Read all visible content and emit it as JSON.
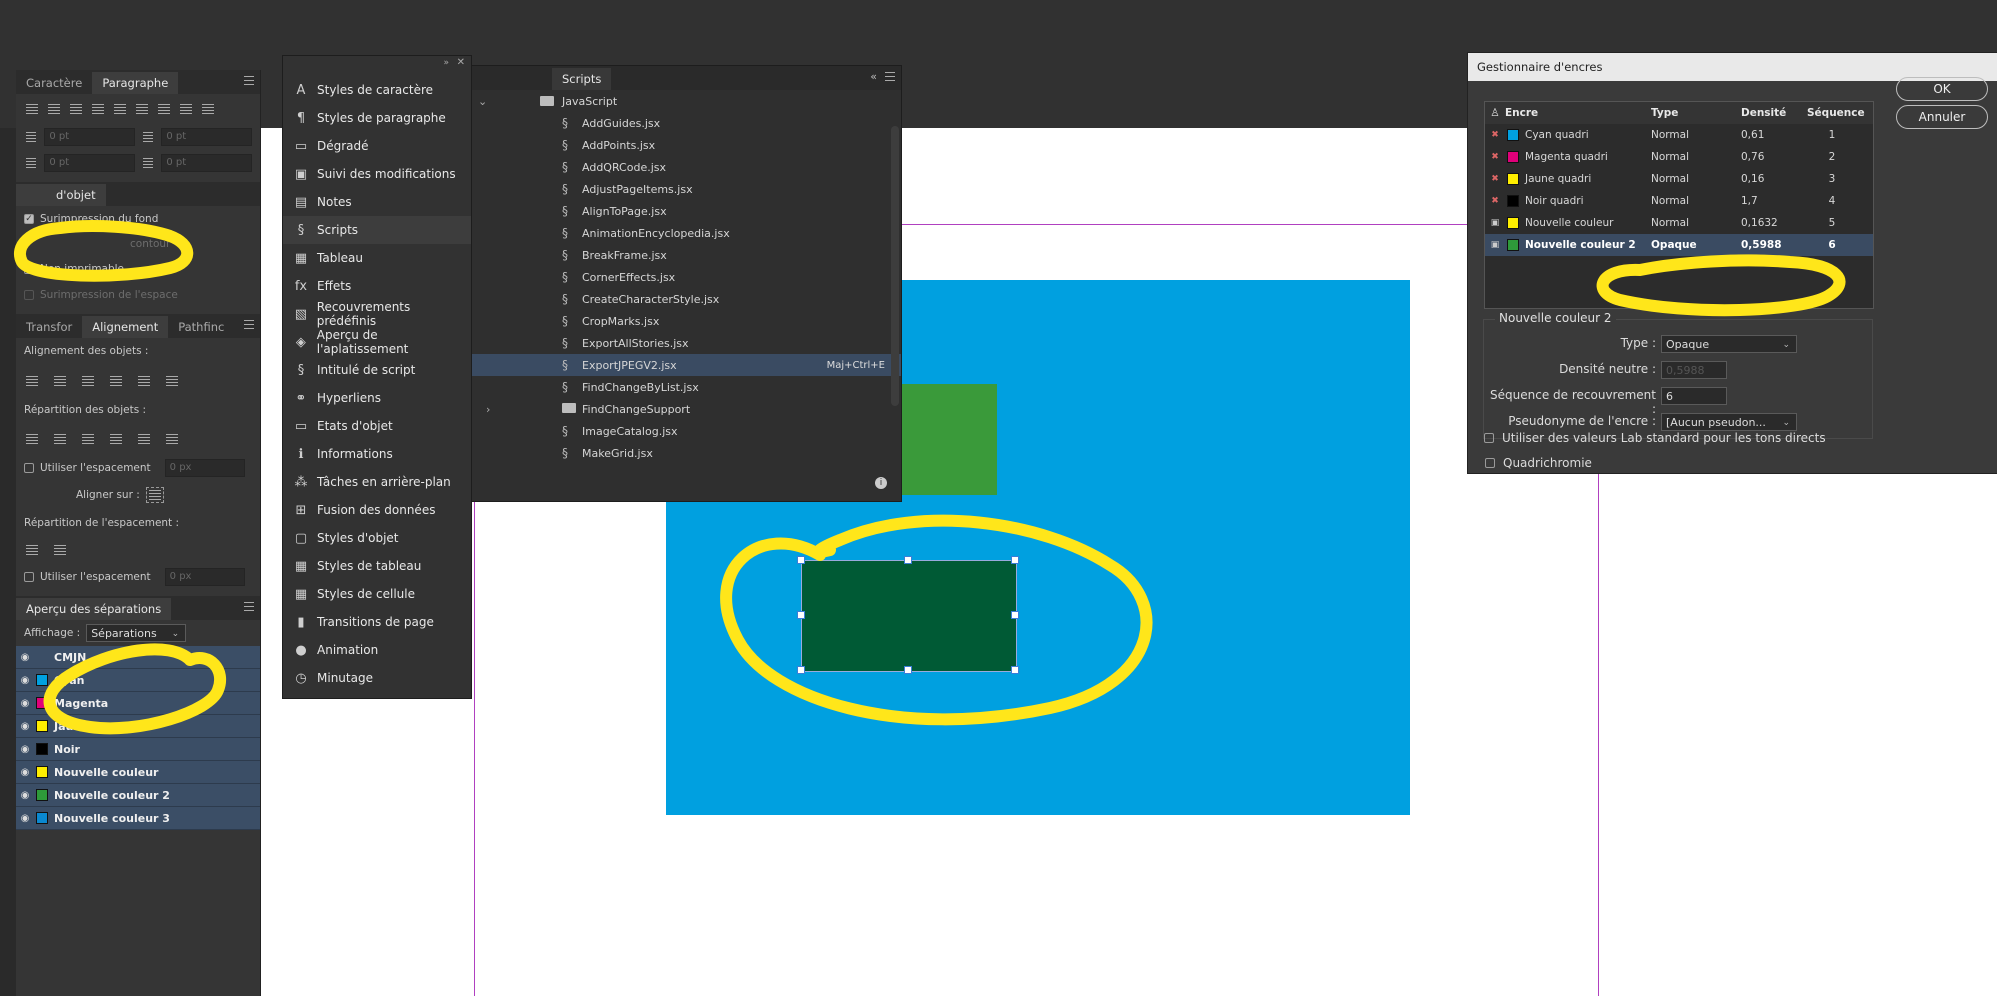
{
  "left_panel": {
    "tabs": [
      "Caractère",
      "Paragraphe"
    ],
    "attributes_header": "d'objet",
    "options": [
      {
        "label": "Surimpression du fond",
        "checked": true
      },
      {
        "label": "contour",
        "checked": false
      },
      {
        "label": "Non imprimable",
        "checked": false
      },
      {
        "label": "Surimpression de l'espace",
        "checked": false
      }
    ],
    "indent_value": "0 pt",
    "align_tabs": [
      "Transfor",
      "Alignement",
      "Pathfinc"
    ],
    "align_objects_label": "Alignement des objets :",
    "distribute_objects_label": "Répartition des objets :",
    "use_spacing_label": "Utiliser l'espacement",
    "spacing_value": "0 px",
    "align_to_label": "Aligner sur :",
    "distribute_spacing_label": "Répartition de l'espacement :"
  },
  "separations": {
    "title": "Aperçu des séparations",
    "display_label": "Affichage :",
    "display_value": "Séparations",
    "rows": [
      {
        "name": "CMJN",
        "color": ""
      },
      {
        "name": "Cyan",
        "color": "#00a0e0"
      },
      {
        "name": "Magenta",
        "color": "#e0007a"
      },
      {
        "name": "Jaune",
        "color": "#ffee00"
      },
      {
        "name": "Noir",
        "color": "#000000"
      },
      {
        "name": "Nouvelle couleur",
        "color": "#ffee00"
      },
      {
        "name": "Nouvelle couleur 2",
        "color": "#2e9a3a"
      },
      {
        "name": "Nouvelle couleur 3",
        "color": "#0a88d0"
      }
    ]
  },
  "menu": {
    "items": [
      {
        "label": "Styles de caractère",
        "icon": "A"
      },
      {
        "label": "Styles de paragraphe",
        "icon": "¶"
      },
      {
        "label": "Dégradé",
        "icon": "▭"
      },
      {
        "label": "Suivi des modifications",
        "icon": "▣"
      },
      {
        "label": "Notes",
        "icon": "▤"
      },
      {
        "label": "Scripts",
        "icon": "§",
        "active": true
      },
      {
        "label": "Tableau",
        "icon": "▦"
      },
      {
        "label": "Effets",
        "icon": "fx"
      },
      {
        "label": "Recouvrements prédéfinis",
        "icon": "▧"
      },
      {
        "label": "Aperçu de l'aplatissement",
        "icon": "◈"
      },
      {
        "label": "Intitulé de script",
        "icon": "§"
      },
      {
        "label": "Hyperliens",
        "icon": "⚭"
      },
      {
        "label": "Etats d'objet",
        "icon": "▭"
      },
      {
        "label": "Informations",
        "icon": "ℹ"
      },
      {
        "label": "Tâches en arrière-plan",
        "icon": "⁂"
      },
      {
        "label": "Fusion des données",
        "icon": "⊞"
      },
      {
        "label": "Styles d'objet",
        "icon": "▢"
      },
      {
        "label": "Styles de tableau",
        "icon": "▦"
      },
      {
        "label": "Styles de cellule",
        "icon": "▦"
      },
      {
        "label": "Transitions de page",
        "icon": "▮"
      },
      {
        "label": "Animation",
        "icon": "●"
      },
      {
        "label": "Minutage",
        "icon": "◷"
      }
    ]
  },
  "scripts": {
    "title": "Scripts",
    "root": "JavaScript",
    "items": [
      {
        "name": "AddGuides.jsx"
      },
      {
        "name": "AddPoints.jsx"
      },
      {
        "name": "AddQRCode.jsx"
      },
      {
        "name": "AdjustPageItems.jsx"
      },
      {
        "name": "AlignToPage.jsx"
      },
      {
        "name": "AnimationEncyclopedia.jsx"
      },
      {
        "name": "BreakFrame.jsx"
      },
      {
        "name": "CornerEffects.jsx"
      },
      {
        "name": "CreateCharacterStyle.jsx"
      },
      {
        "name": "CropMarks.jsx"
      },
      {
        "name": "ExportAllStories.jsx"
      },
      {
        "name": "ExportJPEGV2.jsx",
        "shortcut": "Maj+Ctrl+E",
        "selected": true
      },
      {
        "name": "FindChangeByList.jsx"
      },
      {
        "name": "FindChangeSupport",
        "folder": true
      },
      {
        "name": "ImageCatalog.jsx"
      },
      {
        "name": "MakeGrid.jsx"
      }
    ]
  },
  "ink_manager": {
    "title": "Gestionnaire d'encres",
    "columns": [
      "Encre",
      "Type",
      "Densité",
      "Séquence"
    ],
    "inks": [
      {
        "name": "Cyan quadri",
        "type": "Normal",
        "density": "0,61",
        "seq": "1",
        "color": "#00a0e0"
      },
      {
        "name": "Magenta quadri",
        "type": "Normal",
        "density": "0,76",
        "seq": "2",
        "color": "#e0007a"
      },
      {
        "name": "Jaune quadri",
        "type": "Normal",
        "density": "0,16",
        "seq": "3",
        "color": "#ffee00"
      },
      {
        "name": "Noir quadri",
        "type": "Normal",
        "density": "1,7",
        "seq": "4",
        "color": "#000000"
      },
      {
        "name": "Nouvelle couleur",
        "type": "Normal",
        "density": "0,1632",
        "seq": "5",
        "color": "#ffee00"
      },
      {
        "name": "Nouvelle couleur 2",
        "type": "Opaque",
        "density": "0,5988",
        "seq": "6",
        "color": "#2e9a3a",
        "selected": true
      }
    ],
    "ok": "OK",
    "cancel": "Annuler",
    "group_title": "Nouvelle couleur 2",
    "type_label": "Type :",
    "type_value": "Opaque",
    "neutral_density_label": "Densité neutre :",
    "neutral_density_value": "0,5988",
    "trap_seq_label": "Séquence de recouvrement :",
    "trap_seq_value": "6",
    "alias_label": "Pseudonyme de l'encre :",
    "alias_value": "[Aucun pseudon...",
    "check_quadri": "Quadrichromie",
    "check_lab": "Utiliser des valeurs Lab standard pour les tons directs"
  },
  "colors": {
    "highlight": "#ffe61a",
    "accent_selection": "#3a4b62"
  }
}
